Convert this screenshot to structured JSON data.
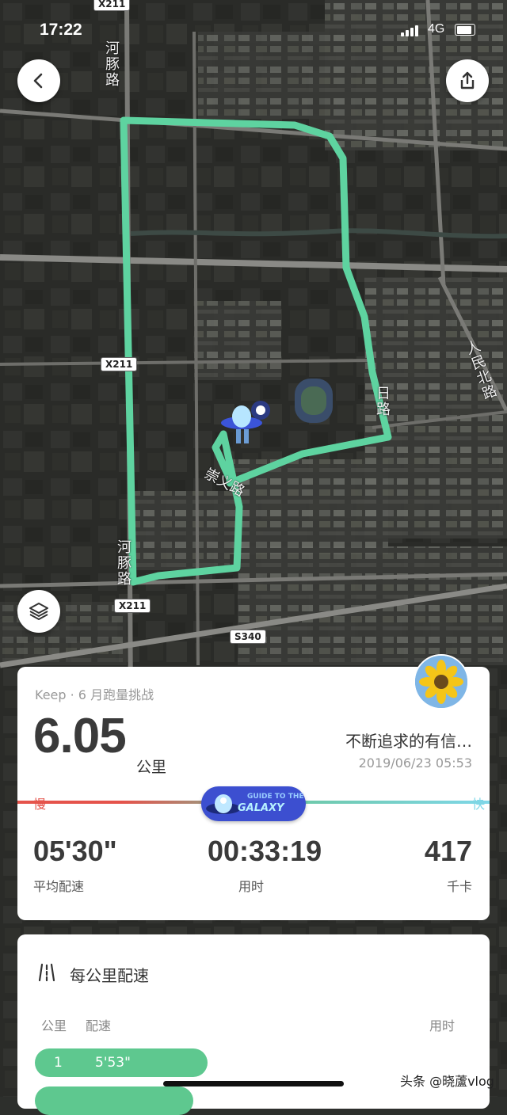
{
  "status_bar": {
    "time": "17:22",
    "network": "4G"
  },
  "map": {
    "road_labels": [
      "X211",
      "X211",
      "X211",
      "S340"
    ],
    "street_names": [
      "河豚路",
      "河豚路",
      "人民北路",
      "崇义路",
      "日路"
    ],
    "route_color": "#5ed3a0"
  },
  "buttons": {
    "back_icon": "chevron-left-icon",
    "share_icon": "share-icon",
    "layers_icon": "layers-icon"
  },
  "summary": {
    "challenge": "Keep · 6 月跑量挑战",
    "distance": "6.05",
    "distance_unit": "公里",
    "username": "不断追求的有信…",
    "datetime": "2019/06/23 05:53",
    "slow_label": "慢",
    "fast_label": "快",
    "badge_line1": "GUIDE TO THE",
    "badge_line2": "GALAXY",
    "stats": [
      {
        "value": "05'30\"",
        "label": "平均配速"
      },
      {
        "value": "00:33:19",
        "label": "用时"
      },
      {
        "value": "417",
        "label": "千卡"
      }
    ]
  },
  "splits": {
    "title": "每公里配速",
    "col_km": "公里",
    "col_pace": "配速",
    "col_time": "用时",
    "rows": [
      {
        "km": "1",
        "pace": "5'53\""
      },
      {
        "km": "",
        "pace": ""
      }
    ]
  },
  "watermark": "头条 @晓蘆vlog",
  "colors": {
    "slow": "#e5534b",
    "fast": "#7fd7e8",
    "split_bar": "#5ec88f"
  }
}
